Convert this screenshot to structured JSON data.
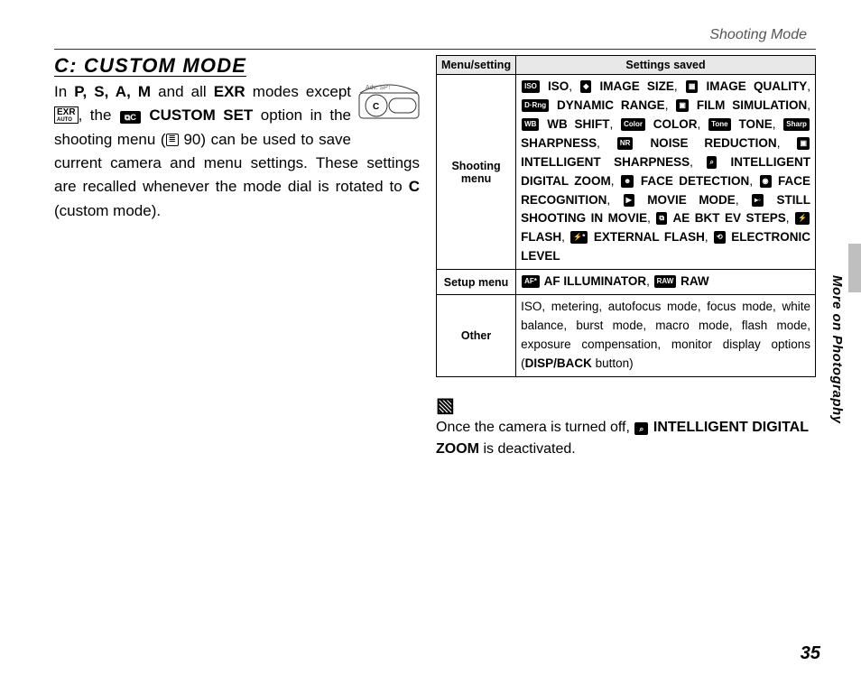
{
  "header": {
    "section": "Shooting Mode",
    "side": "More on Photography",
    "page": "35"
  },
  "title": "C: CUSTOM MODE",
  "intro": {
    "pre": "In ",
    "modes": "P, S, A, M",
    "p1": " and all ",
    "exr": "EXR",
    "p2": " modes except ",
    "exrauto_top": "EXR",
    "exrauto_bot": "AUTO",
    "p3": ", the ",
    "custicon": "⧉C",
    "cust": " CUSTOM SET",
    "p4": " option in the shooting menu (",
    "ref": "≣",
    "refpage": " 90",
    "p5": ") can be used to save current camera and menu settings.  These settings are recalled whenever the mode dial is rotated to ",
    "c": "C",
    "p6": " (custom mode)."
  },
  "table": {
    "h1": "Menu/setting",
    "h2": "Settings saved",
    "rows": [
      {
        "label": "Shooting menu",
        "items": [
          {
            "icon": "ISO",
            "text": "ISO"
          },
          {
            "icon": "◆",
            "text": "IMAGE SIZE"
          },
          {
            "icon": "▦",
            "text": "IMAGE QUALITY"
          },
          {
            "icon": "D·Rng",
            "text": "DYNAMIC RANGE"
          },
          {
            "icon": "▣",
            "text": "FILM SIMULATION"
          },
          {
            "icon": "WB",
            "text": "WB SHIFT"
          },
          {
            "icon": "Color",
            "text": "COLOR"
          },
          {
            "icon": "Tone",
            "text": "TONE"
          },
          {
            "icon": "Sharp",
            "text": "SHARPNESS"
          },
          {
            "icon": "NR",
            "text": "NOISE REDUCTION"
          },
          {
            "icon": "▣",
            "text": "INTELLIGENT SHARPNESS"
          },
          {
            "icon": "⌕",
            "text": "INTELLIGENT DIGITAL ZOOM"
          },
          {
            "icon": "☻",
            "text": "FACE DETECTION"
          },
          {
            "icon": "◉",
            "text": "FACE RECOGNITION"
          },
          {
            "icon": "▶",
            "text": "MOVIE MODE"
          },
          {
            "icon": "▸◦",
            "text": "STILL SHOOTING IN MOVIE"
          },
          {
            "icon": "⧉",
            "text": "AE BKT EV STEPS"
          },
          {
            "icon": "⚡",
            "text": "FLASH"
          },
          {
            "icon": "⚡*",
            "text": "EXTERNAL FLASH"
          },
          {
            "icon": "⟲",
            "text": "ELECTRONIC LEVEL"
          }
        ]
      },
      {
        "label": "Setup menu",
        "items": [
          {
            "icon": "AF*",
            "text": "AF ILLUMINATOR"
          },
          {
            "icon": "RAW",
            "text": "RAW"
          }
        ]
      },
      {
        "label": "Other",
        "plain": "ISO, metering, autofocus mode, focus mode, white balance, burst mode, macro mode, flash mode, exposure compensation, monitor display options (",
        "btn": "DISP/BACK",
        "plain2": " button)"
      }
    ]
  },
  "note": {
    "icon": "▧",
    "p1": "Once the camera is turned off, ",
    "zicon": "⌕",
    "z": " INTELLIGENT DIGITAL ZOOM",
    "p2": " is deactivated."
  }
}
